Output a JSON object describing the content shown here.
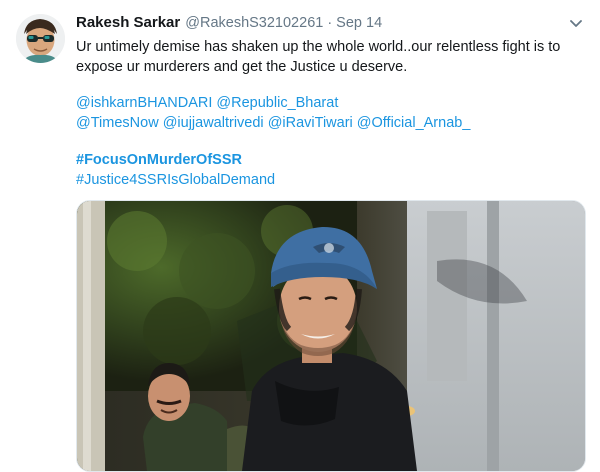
{
  "tweet": {
    "display_name": "Rakesh Sarkar",
    "handle": "@RakeshS32102261",
    "separator": "·",
    "date": "Sep 14",
    "text_line1": "Ur untimely demise has shaken up the whole world..our relentless fight is to",
    "text_line2": "expose ur murderers and get the Justice u deserve.",
    "mentions_line1": [
      "@ishkarnBHANDARI",
      "@Republic_Bharat"
    ],
    "mentions_line2": [
      "@TimesNow",
      "@iujjawaltrivedi",
      "@iRaviTiwari",
      "@Official_Arnab_"
    ],
    "hashtag1": "#FocusOnMurderOfSSR",
    "hashtag2": "#Justice4SSRIsGlobalDemand"
  },
  "icons": {
    "caret": "chevron-down-icon",
    "avatar": "avatar-photo"
  },
  "colors": {
    "link": "#1b95e0",
    "secondary_text": "#657786",
    "primary_text": "#14171a",
    "cap": "#3f6fa3"
  }
}
